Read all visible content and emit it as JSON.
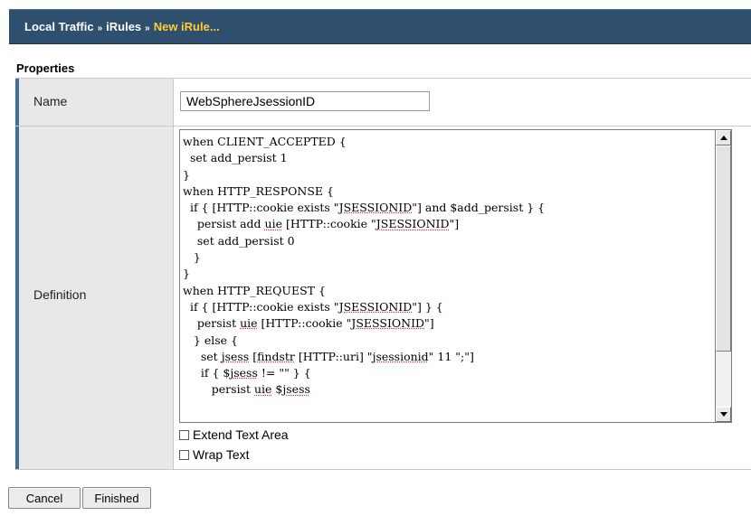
{
  "header": {
    "breadcrumb": [
      {
        "label": "Local Traffic",
        "current": false
      },
      {
        "label": "iRules",
        "current": false
      },
      {
        "label": "New iRule...",
        "current": true
      }
    ],
    "separator": "»",
    "bar_color": "#2f4f6f",
    "current_color": "#ffcc33"
  },
  "section": {
    "title": "Properties"
  },
  "form": {
    "name_label": "Name",
    "name_value": "WebSphereJsessionID",
    "definition_label": "Definition",
    "definition_code": [
      "when CLIENT_ACCEPTED {",
      "  set add_persist 1",
      "}",
      "when HTTP_RESPONSE {",
      "  if { [HTTP::cookie exists \"JSESSIONID\"] and $add_persist } {",
      "    persist add uie [HTTP::cookie \"JSESSIONID\"]",
      "    set add_persist 0",
      "   }",
      "}",
      "when HTTP_REQUEST {",
      "  if { [HTTP::cookie exists \"JSESSIONID\"] } {",
      "    persist uie [HTTP::cookie \"JSESSIONID\"]",
      "   } else {",
      "     set jsess [findstr [HTTP::uri] \"jsessionid\" 11 \";\"]",
      "     if { $jsess != \"\" } {",
      "        persist uie $jsess"
    ],
    "extend_text_area_label": "Extend Text Area",
    "extend_text_area_checked": false,
    "wrap_text_label": "Wrap Text",
    "wrap_text_checked": false
  },
  "actions": {
    "cancel_label": "Cancel",
    "finished_label": "Finished"
  },
  "accent_color": "#3f6f9c"
}
